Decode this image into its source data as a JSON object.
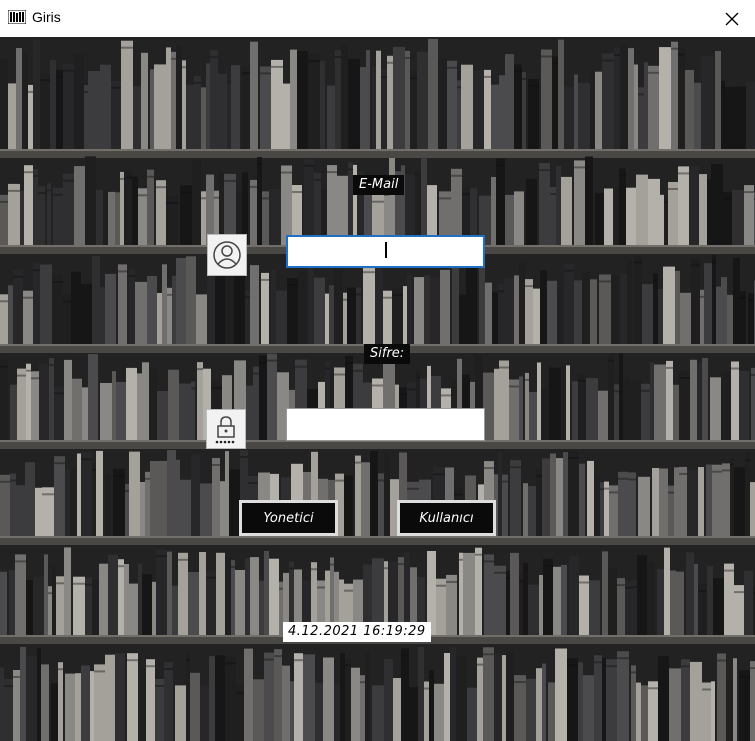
{
  "window": {
    "title": "Giris"
  },
  "form": {
    "email_label": "E-Mail",
    "email_value": "",
    "password_label": "Sifre:",
    "password_value": ""
  },
  "buttons": {
    "admin": "Yonetici",
    "user": "Kullanıcı"
  },
  "status": {
    "datetime": "4.12.2021 16:19:29"
  },
  "icons": {
    "app": "bookshelf-icon",
    "close": "close-icon",
    "user": "user-circle-icon",
    "password": "padlock-icon"
  },
  "colors": {
    "label_bg": "#0a0a0a",
    "focus_border": "#1f6fc5",
    "button_border": "#dedede"
  }
}
